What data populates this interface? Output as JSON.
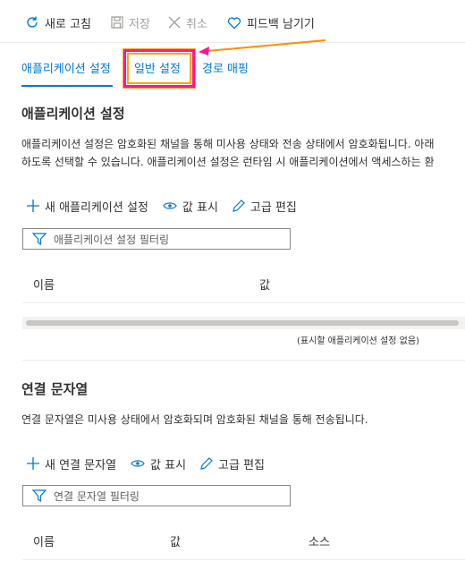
{
  "toolbar": {
    "refresh": "새로 고침",
    "save": "저장",
    "discard": "취소",
    "feedback": "피드백 남기기"
  },
  "tabs": [
    {
      "label": "애플리케이션 설정",
      "active": true
    },
    {
      "label": "일반 설정",
      "active": false
    },
    {
      "label": "경로 매핑",
      "active": false
    }
  ],
  "app_settings": {
    "title": "애플리케이션 설정",
    "desc_line1": "애플리케이션 설정은 암호화된 채널을 통해 미사용 상태와 전송 상태에서 암호화됩니다. 아래",
    "desc_line2": "하도록 선택할 수 있습니다. 애플리케이션 설정은 런타임 시 애플리케이션에서 액세스하는 환",
    "new_label": "새 애플리케이션 설정",
    "show_values": "값 표시",
    "advanced_edit": "고급 편집",
    "filter_placeholder": "애플리케이션 설정 필터링",
    "col_name": "이름",
    "col_value": "값",
    "empty_message": "(표시할 애플리케이션 설정 없음)"
  },
  "connection_strings": {
    "title": "연결 문자열",
    "desc": "연결 문자열은 미사용 상태에서 암호화되며 암호화된 채널을 통해 전송됩니다.",
    "new_label": "새 연결 문자열",
    "show_values": "값 표시",
    "advanced_edit": "고급 편집",
    "filter_placeholder": "연결 문자열 필터링",
    "col_name": "이름",
    "col_value": "값",
    "col_source": "소스"
  },
  "colors": {
    "accent": "#0078d4",
    "highlight": "#ff1493",
    "arrow": "#ff8c00"
  }
}
